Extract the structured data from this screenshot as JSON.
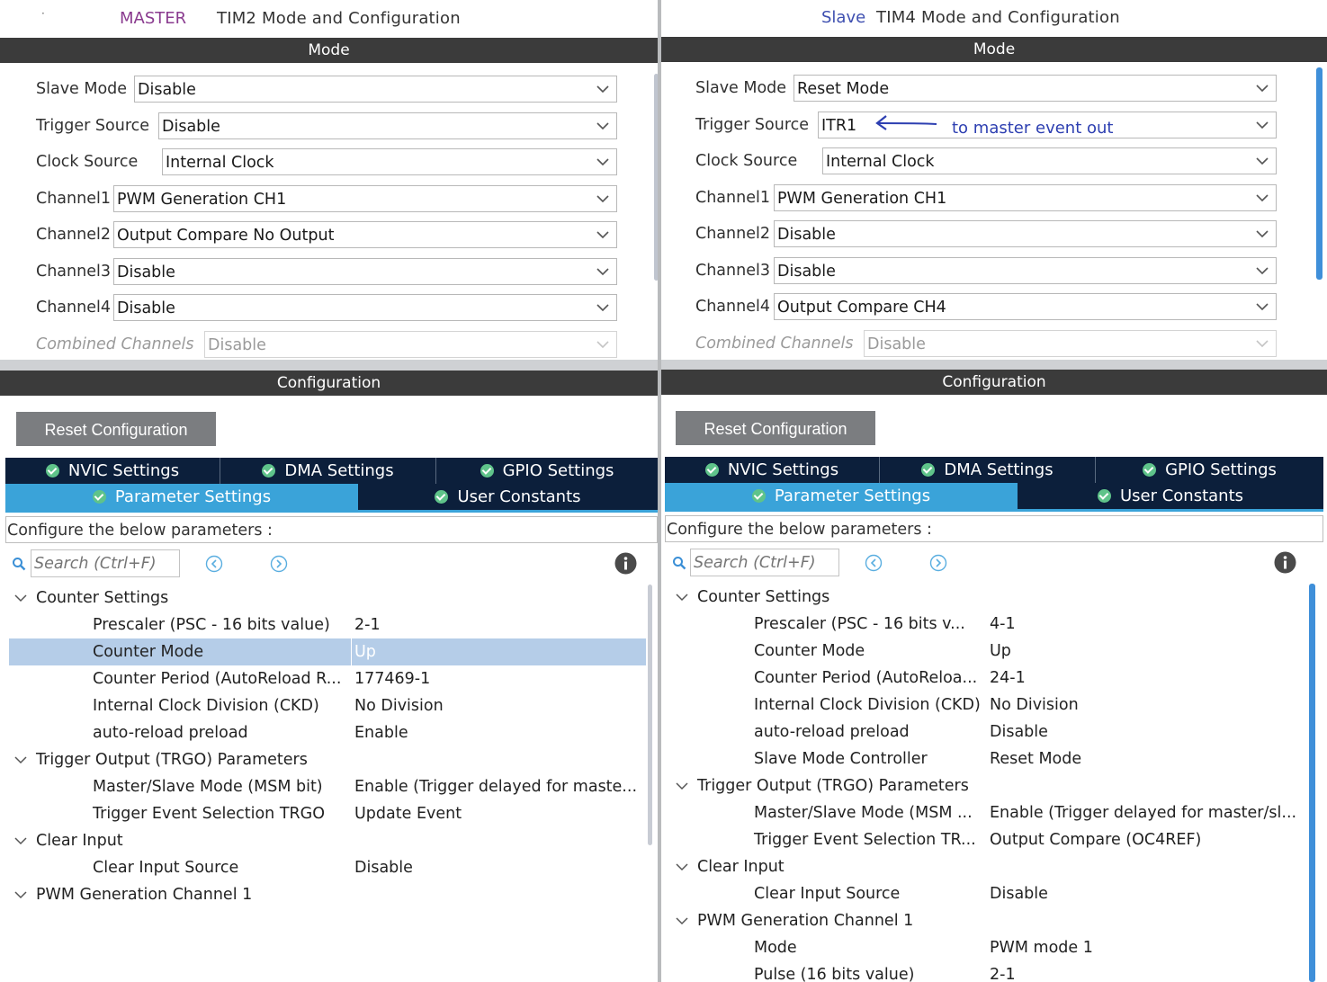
{
  "master": {
    "title_role": "MASTER",
    "title_name": "TIM2 Mode and Configuration",
    "mode_header": "Mode",
    "fields": [
      {
        "label": "Slave Mode",
        "value": "Disable"
      },
      {
        "label": "Trigger Source",
        "value": "Disable"
      },
      {
        "label": "Clock Source",
        "value": "Internal Clock"
      },
      {
        "label": "Channel1",
        "value": "PWM Generation CH1"
      },
      {
        "label": "Channel2",
        "value": "Output Compare No Output"
      },
      {
        "label": "Channel3",
        "value": "Disable"
      },
      {
        "label": "Channel4",
        "value": "Disable"
      },
      {
        "label": "Combined Channels",
        "value": "Disable"
      }
    ],
    "config_header": "Configuration",
    "reset_label": "Reset Configuration",
    "tabs_row1": [
      "NVIC Settings",
      "DMA Settings",
      "GPIO Settings"
    ],
    "tabs_row2": [
      "Parameter Settings",
      "User Constants"
    ],
    "configure_text": "Configure the below parameters :",
    "search_placeholder": "Search (Ctrl+F)",
    "tree": [
      {
        "type": "group",
        "name": "Counter Settings"
      },
      {
        "type": "param",
        "name": "Prescaler (PSC - 16 bits value)",
        "value": "2-1"
      },
      {
        "type": "param",
        "name": "Counter Mode",
        "value": "Up",
        "selected": true
      },
      {
        "type": "param",
        "name": "Counter Period (AutoReload R...",
        "value": "177469-1"
      },
      {
        "type": "param",
        "name": "Internal Clock Division (CKD)",
        "value": "No Division"
      },
      {
        "type": "param",
        "name": "auto-reload preload",
        "value": "Enable"
      },
      {
        "type": "group",
        "name": "Trigger Output (TRGO) Parameters"
      },
      {
        "type": "param",
        "name": "Master/Slave Mode (MSM bit)",
        "value": "Enable (Trigger delayed for maste..."
      },
      {
        "type": "param",
        "name": "Trigger Event Selection TRGO",
        "value": "Update Event"
      },
      {
        "type": "group",
        "name": "Clear Input"
      },
      {
        "type": "param",
        "name": "Clear Input Source",
        "value": "Disable"
      },
      {
        "type": "group",
        "name": "PWM Generation Channel 1"
      }
    ]
  },
  "slave": {
    "title_role": "Slave",
    "title_name": "TIM4 Mode and Configuration",
    "mode_header": "Mode",
    "annotation": "to master event out",
    "fields": [
      {
        "label": "Slave Mode",
        "value": "Reset Mode"
      },
      {
        "label": "Trigger Source",
        "value": "ITR1"
      },
      {
        "label": "Clock Source",
        "value": "Internal Clock"
      },
      {
        "label": "Channel1",
        "value": "PWM Generation CH1"
      },
      {
        "label": "Channel2",
        "value": "Disable"
      },
      {
        "label": "Channel3",
        "value": "Disable"
      },
      {
        "label": "Channel4",
        "value": "Output Compare CH4"
      },
      {
        "label": "Combined Channels",
        "value": "Disable"
      }
    ],
    "config_header": "Configuration",
    "reset_label": "Reset Configuration",
    "tabs_row1": [
      "NVIC Settings",
      "DMA Settings",
      "GPIO Settings"
    ],
    "tabs_row2": [
      "Parameter Settings",
      "User Constants"
    ],
    "configure_text": "Configure the below parameters :",
    "search_placeholder": "Search (Ctrl+F)",
    "tree": [
      {
        "type": "group",
        "name": "Counter Settings"
      },
      {
        "type": "param",
        "name": "Prescaler (PSC - 16 bits v...",
        "value": "4-1"
      },
      {
        "type": "param",
        "name": "Counter Mode",
        "value": "Up"
      },
      {
        "type": "param",
        "name": "Counter Period (AutoReloa...",
        "value": "24-1"
      },
      {
        "type": "param",
        "name": "Internal Clock Division (CKD)",
        "value": "No Division"
      },
      {
        "type": "param",
        "name": "auto-reload preload",
        "value": "Disable"
      },
      {
        "type": "param",
        "name": "Slave Mode Controller",
        "value": "Reset Mode"
      },
      {
        "type": "group",
        "name": "Trigger Output (TRGO) Parameters"
      },
      {
        "type": "param",
        "name": "Master/Slave Mode (MSM ...",
        "value": "Enable (Trigger delayed for master/sl..."
      },
      {
        "type": "param",
        "name": "Trigger Event Selection TR...",
        "value": "Output Compare (OC4REF)"
      },
      {
        "type": "group",
        "name": "Clear Input"
      },
      {
        "type": "param",
        "name": "Clear Input Source",
        "value": "Disable"
      },
      {
        "type": "group",
        "name": "PWM Generation Channel 1"
      },
      {
        "type": "param",
        "name": "Mode",
        "value": "PWM mode 1"
      },
      {
        "type": "param",
        "name": "Pulse (16 bits value)",
        "value": "2-1"
      }
    ]
  },
  "colors": {
    "master_role": "#8a3b8f",
    "slave_role": "#3e4fb0",
    "header_bg": "#3b3b3b",
    "tab_bg": "#0c1f3b",
    "tab_active": "#3aa3d9",
    "annotation": "#2d3fb1",
    "selection": "#b5cde8"
  }
}
